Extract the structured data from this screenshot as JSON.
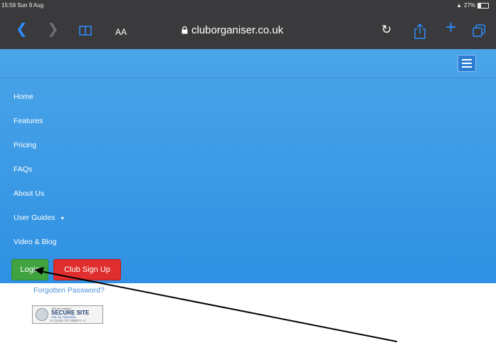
{
  "status_bar": {
    "time": "15:59  Sun 9 Aug",
    "battery": "27%"
  },
  "toolbar": {
    "reader_label": "AA",
    "url": "cluborganiser.co.uk",
    "icons": [
      "back-icon",
      "forward-icon",
      "bookmarks-icon",
      "lock-icon",
      "reload-icon",
      "share-icon",
      "new-tab-icon",
      "tabs-icon"
    ]
  },
  "nav": {
    "items": [
      {
        "label": "Home"
      },
      {
        "label": "Features"
      },
      {
        "label": "Pricing"
      },
      {
        "label": "FAQs"
      },
      {
        "label": "About Us"
      },
      {
        "label": "User Guides"
      },
      {
        "label": "Video & Blog"
      }
    ]
  },
  "buttons": {
    "login": "Login",
    "signup": "Club Sign Up"
  },
  "forgot_password": "Forgotten Password?",
  "ssl_badge": {
    "line1": "256-bit enabled",
    "line2": "SECURE SITE",
    "line3": "SSL by AlphaSSL",
    "line4": ">> CLICK TO VERIFY <<"
  },
  "colors": {
    "browser_chrome": "#3a3a3c",
    "site_blue": "#3e9ae6",
    "login_green": "#3fa43f",
    "signup_red": "#e02d2d",
    "link_blue": "#4a90d9"
  }
}
